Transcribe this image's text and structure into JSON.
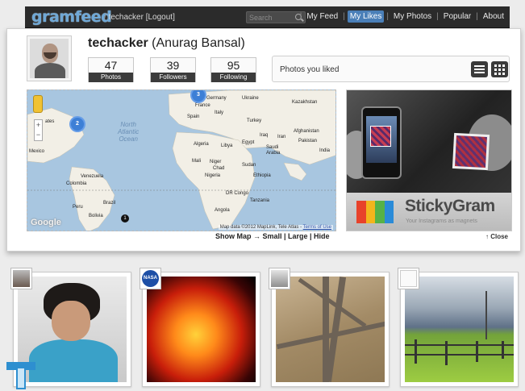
{
  "header": {
    "logo": "gramfeed",
    "breadcrumb_prefix": "/",
    "user": "techacker",
    "logout": "[Logout]",
    "search_placeholder": "Search",
    "nav": [
      "My Feed",
      "My Likes",
      "My Photos",
      "Popular",
      "About"
    ],
    "active_nav": "My Likes",
    "active_color": "#4a7fb8"
  },
  "profile": {
    "username": "techacker",
    "fullname": "(Anurag Bansal)",
    "stats": [
      {
        "value": "47",
        "label": "Photos"
      },
      {
        "value": "39",
        "label": "Followers"
      },
      {
        "value": "95",
        "label": "Following"
      }
    ],
    "liked_text": "Photos you liked"
  },
  "map": {
    "labels": [
      "North",
      "Atlantic",
      "Ocean"
    ],
    "countries": [
      "Kazakhstan",
      "Ukraine",
      "Germany",
      "France",
      "Italy",
      "Spain",
      "Turkey",
      "Iraq",
      "Iran",
      "Afghanistan",
      "Pakistan",
      "India",
      "Algeria",
      "Libya",
      "Egypt",
      "Saudi",
      "Arabia",
      "Mali",
      "Niger",
      "Chad",
      "Sudan",
      "Nigeria",
      "Ethiopia",
      "DR Congo",
      "Tanzania",
      "Angola",
      "Venezuela",
      "Colombia",
      "Peru",
      "Brazil",
      "Bolivia",
      "Mexico",
      "ates"
    ],
    "clusters": [
      {
        "count": "2"
      },
      {
        "count": "3"
      }
    ],
    "pin": "1",
    "credit": "Map data ©2012 MapLink, Tele Atlas - ",
    "credit_link": "Terms of Use",
    "google": "Google",
    "controls": "Show Map → Small | Large | Hide"
  },
  "ad": {
    "title": "StickyGram",
    "tagline": "Your Instagrams as magnets",
    "close": "↑ Close",
    "bar_colors": [
      "#e8422a",
      "#f3b51c",
      "#56b247",
      "#2a8bd8"
    ]
  },
  "photos": [
    {
      "badge": "user-avatar",
      "subject": "portrait"
    },
    {
      "badge": "NASA",
      "subject": "sun"
    },
    {
      "badge": "user-avatar",
      "subject": "highway"
    },
    {
      "badge": "user-avatar",
      "subject": "field"
    }
  ]
}
